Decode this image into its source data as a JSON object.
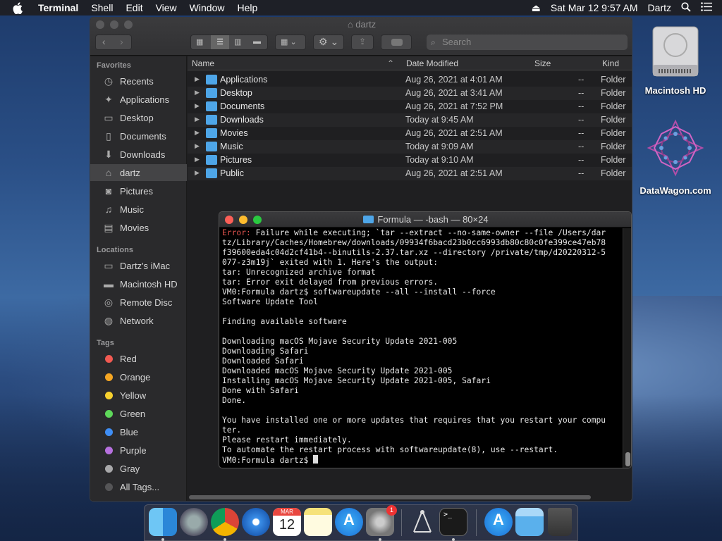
{
  "menubar": {
    "app": "Terminal",
    "items": [
      "Shell",
      "Edit",
      "View",
      "Window",
      "Help"
    ],
    "clock": "Sat Mar 12  9:57 AM",
    "user": "Dartz"
  },
  "finder": {
    "title": "dartz",
    "search_placeholder": "Search",
    "sidebar": {
      "favorites_label": "Favorites",
      "favorites": [
        "Recents",
        "Applications",
        "Desktop",
        "Documents",
        "Downloads",
        "dartz",
        "Pictures",
        "Music",
        "Movies"
      ],
      "locations_label": "Locations",
      "locations": [
        "Dartz's iMac",
        "Macintosh HD",
        "Remote Disc",
        "Network"
      ],
      "tags_label": "Tags",
      "tags": [
        {
          "name": "Red",
          "color": "#f25a52"
        },
        {
          "name": "Orange",
          "color": "#f5a623"
        },
        {
          "name": "Yellow",
          "color": "#f7d12e"
        },
        {
          "name": "Green",
          "color": "#5ed85a"
        },
        {
          "name": "Blue",
          "color": "#3f8ef5"
        },
        {
          "name": "Purple",
          "color": "#b670de"
        },
        {
          "name": "Gray",
          "color": "#a8a8aa"
        },
        {
          "name": "All Tags...",
          "color": "#555557"
        }
      ]
    },
    "columns": {
      "name": "Name",
      "date": "Date Modified",
      "size": "Size",
      "kind": "Kind"
    },
    "rows": [
      {
        "name": "Applications",
        "date": "Aug 26, 2021 at 4:01 AM",
        "size": "--",
        "kind": "Folder"
      },
      {
        "name": "Desktop",
        "date": "Aug 26, 2021 at 3:41 AM",
        "size": "--",
        "kind": "Folder"
      },
      {
        "name": "Documents",
        "date": "Aug 26, 2021 at 7:52 PM",
        "size": "--",
        "kind": "Folder"
      },
      {
        "name": "Downloads",
        "date": "Today at 9:45 AM",
        "size": "--",
        "kind": "Folder"
      },
      {
        "name": "Movies",
        "date": "Aug 26, 2021 at 2:51 AM",
        "size": "--",
        "kind": "Folder"
      },
      {
        "name": "Music",
        "date": "Today at 9:09 AM",
        "size": "--",
        "kind": "Folder"
      },
      {
        "name": "Pictures",
        "date": "Today at 9:10 AM",
        "size": "--",
        "kind": "Folder"
      },
      {
        "name": "Public",
        "date": "Aug 26, 2021 at 2:51 AM",
        "size": "--",
        "kind": "Folder"
      }
    ]
  },
  "terminal": {
    "title": "Formula — -bash — 80×24",
    "lines": [
      {
        "err": "Error:",
        "text": " Failure while executing; `tar --extract --no-same-owner --file /Users/dar"
      },
      {
        "text": "tz/Library/Caches/Homebrew/downloads/09934f6bacd23b0cc6993db80c80c0fe399ce47eb78"
      },
      {
        "text": "f39600eda4c04d2cf41b4--binutils-2.37.tar.xz --directory /private/tmp/d20220312-5"
      },
      {
        "text": "077-z3m19j` exited with 1. Here's the output:"
      },
      {
        "text": "tar: Unrecognized archive format"
      },
      {
        "text": "tar: Error exit delayed from previous errors."
      },
      {
        "text": "VM0:Formula dartz$ softwareupdate --all --install --force"
      },
      {
        "text": "Software Update Tool"
      },
      {
        "text": ""
      },
      {
        "text": "Finding available software"
      },
      {
        "text": ""
      },
      {
        "text": "Downloading macOS Mojave Security Update 2021-005"
      },
      {
        "text": "Downloading Safari"
      },
      {
        "text": "Downloaded Safari"
      },
      {
        "text": "Downloaded macOS Mojave Security Update 2021-005"
      },
      {
        "text": "Installing macOS Mojave Security Update 2021-005, Safari"
      },
      {
        "text": "Done with Safari"
      },
      {
        "text": "Done."
      },
      {
        "text": ""
      },
      {
        "text": "You have installed one or more updates that requires that you restart your compu"
      },
      {
        "text": "ter."
      },
      {
        "text": "Please restart immediately."
      },
      {
        "text": "To automate the restart process with softwareupdate(8), use --restart."
      },
      {
        "text": "VM0:Formula dartz$ "
      }
    ]
  },
  "desktop": {
    "icons": [
      "Macintosh HD",
      "DataWagon.com"
    ]
  },
  "dock": {
    "apps": [
      "finder",
      "launchpad",
      "chrome",
      "safari",
      "calendar",
      "notes",
      "app-store",
      "system-preferences",
      "directory-utility",
      "terminal",
      "app-store-folder",
      "documents-folder",
      "trash"
    ],
    "calendar_month": "MAR",
    "calendar_day": "12",
    "badge": "1"
  }
}
